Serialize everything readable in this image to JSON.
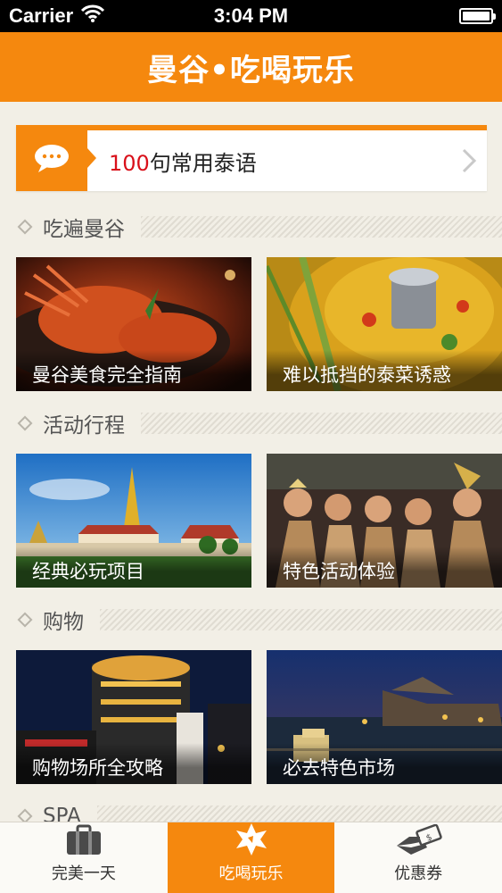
{
  "status_bar": {
    "carrier": "Carrier",
    "time": "3:04 PM",
    "wifi_icon": "wifi-icon",
    "battery_icon": "battery-icon",
    "battery_level": 1.0
  },
  "header": {
    "title": "曼谷•吃喝玩乐"
  },
  "phrase_banner": {
    "icon": "speech-bubble-icon",
    "number": "100",
    "label": "句常用泰语",
    "chevron": "chevron-right-icon"
  },
  "sections": [
    {
      "title": "吃遍曼谷",
      "cards": [
        {
          "caption": "曼谷美食完全指南"
        },
        {
          "caption": "难以抵挡的泰菜诱惑"
        }
      ]
    },
    {
      "title": "活动行程",
      "cards": [
        {
          "caption": "经典必玩项目"
        },
        {
          "caption": "特色活动体验"
        }
      ]
    },
    {
      "title": "购物",
      "cards": [
        {
          "caption": "购物场所全攻略"
        },
        {
          "caption": "必去特色市场"
        }
      ]
    },
    {
      "title": "SPA",
      "cards": []
    }
  ],
  "tabs": [
    {
      "label": "完美一天",
      "icon": "suitcase-icon",
      "active": false
    },
    {
      "label": "吃喝玩乐",
      "icon": "starburst-icon",
      "active": true
    },
    {
      "label": "优惠券",
      "icon": "coupon-hand-icon",
      "active": false
    }
  ],
  "colors": {
    "accent": "#f5880e",
    "background": "#f2efe6",
    "highlight_number": "#d9101a"
  }
}
